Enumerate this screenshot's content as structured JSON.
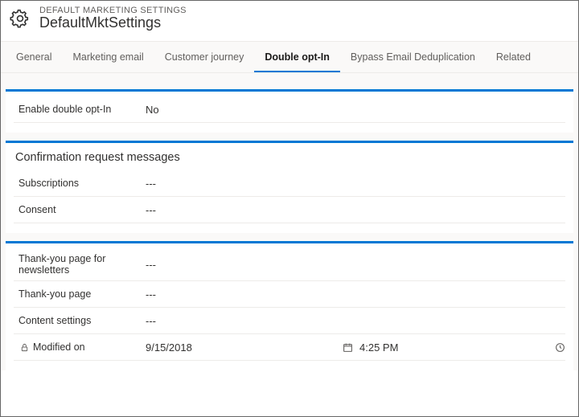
{
  "header": {
    "entityLabel": "DEFAULT MARKETING SETTINGS",
    "title": "DefaultMktSettings"
  },
  "tabs": {
    "items": [
      {
        "label": "General",
        "name": "tab-general"
      },
      {
        "label": "Marketing email",
        "name": "tab-marketing-email"
      },
      {
        "label": "Customer journey",
        "name": "tab-customer-journey"
      },
      {
        "label": "Double opt-In",
        "name": "tab-double-opt-in"
      },
      {
        "label": "Bypass Email Deduplication",
        "name": "tab-bypass-email-dedup"
      },
      {
        "label": "Related",
        "name": "tab-related"
      }
    ],
    "activeIndex": 3
  },
  "section1": {
    "fields": {
      "enableDoubleOptIn": {
        "label": "Enable double opt-In",
        "value": "No"
      }
    }
  },
  "section2": {
    "title": "Confirmation request messages",
    "fields": {
      "subscriptions": {
        "label": "Subscriptions",
        "value": "---"
      },
      "consent": {
        "label": "Consent",
        "value": "---"
      }
    }
  },
  "section3": {
    "fields": {
      "thankYouNewsletters": {
        "label": "Thank-you page for newsletters",
        "value": "---"
      },
      "thankYouPage": {
        "label": "Thank-you page",
        "value": "---"
      },
      "contentSettings": {
        "label": "Content settings",
        "value": "---"
      },
      "modifiedOn": {
        "label": "Modified on",
        "date": "9/15/2018",
        "time": "4:25 PM"
      }
    }
  }
}
